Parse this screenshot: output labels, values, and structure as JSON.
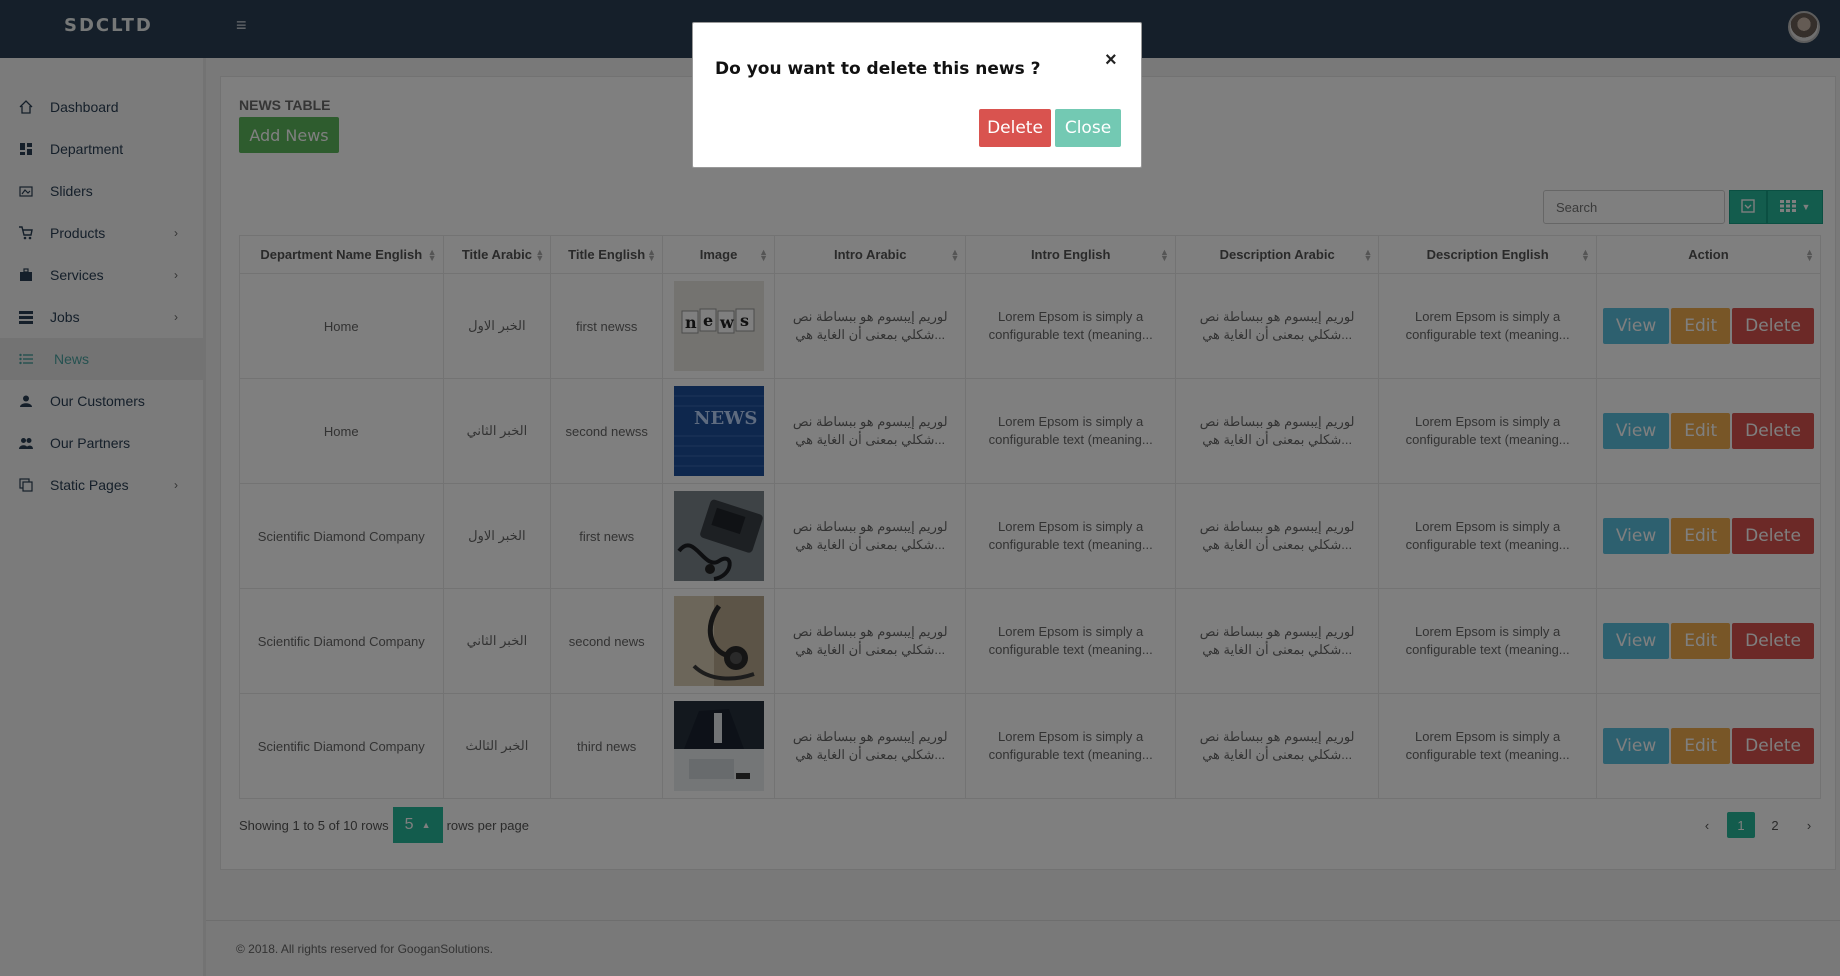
{
  "app": {
    "brand": "SDCLTD"
  },
  "sidebar": {
    "items": [
      {
        "label": "Dashboard",
        "icon": "home-icon",
        "has_children": false
      },
      {
        "label": "Department",
        "icon": "dashboard-grid-icon",
        "has_children": false
      },
      {
        "label": "Sliders",
        "icon": "sliders-icon",
        "has_children": false
      },
      {
        "label": "Products",
        "icon": "cart-icon",
        "has_children": true
      },
      {
        "label": "Services",
        "icon": "briefcase-icon",
        "has_children": true
      },
      {
        "label": "Jobs",
        "icon": "list-icon",
        "has_children": true
      },
      {
        "label": "News",
        "icon": "list-bullet-icon",
        "has_children": false,
        "active": true
      },
      {
        "label": "Our Customers",
        "icon": "person-icon",
        "has_children": false
      },
      {
        "label": "Our Partners",
        "icon": "people-icon",
        "has_children": false
      },
      {
        "label": "Static Pages",
        "icon": "pages-icon",
        "has_children": true
      }
    ]
  },
  "main": {
    "panel_title": "NEWS TABLE",
    "add_button": "Add News",
    "search_placeholder": "Search",
    "columns": [
      "Department Name English",
      "Title Arabic",
      "Title English",
      "Image",
      "Intro Arabic",
      "Intro English",
      "Description Arabic",
      "Description English",
      "Action"
    ],
    "rows": [
      {
        "dept": "Home",
        "title_ar": "الخبر الاول",
        "title_en": "first newss",
        "image": "news-letters",
        "intro_ar_1": "لوريم إيبسوم هو ببساطة نص",
        "intro_ar_2": "...شكلي بمعنى أن الغاية هي",
        "intro_en_1": "Lorem Epsom is simply a",
        "intro_en_2": "configurable text (meaning...",
        "desc_ar_1": "لوريم إيبسوم هو ببساطة نص",
        "desc_ar_2": "...شكلي بمعنى أن الغاية هي",
        "desc_en_1": "Lorem Epsom is simply a",
        "desc_en_2": "configurable text (meaning..."
      },
      {
        "dept": "Home",
        "title_ar": "الخبر الثاني",
        "title_en": "second newss",
        "image": "news-blue-screen",
        "intro_ar_1": "لوريم إيبسوم هو ببساطة نص",
        "intro_ar_2": "...شكلي بمعنى أن الغاية هي",
        "intro_en_1": "Lorem Epsom is simply a",
        "intro_en_2": "configurable text (meaning...",
        "desc_ar_1": "لوريم إيبسوم هو ببساطة نص",
        "desc_ar_2": "...شكلي بمعنى أن الغاية هي",
        "desc_en_1": "Lorem Epsom is simply a",
        "desc_en_2": "configurable text (meaning..."
      },
      {
        "dept": "Scientific Diamond Company",
        "title_ar": "الخبر الاول",
        "title_en": "first news",
        "image": "medical-device",
        "intro_ar_1": "لوريم إيبسوم هو ببساطة نص",
        "intro_ar_2": "...شكلي بمعنى أن الغاية هي",
        "intro_en_1": "Lorem Epsom is simply a",
        "intro_en_2": "configurable text (meaning...",
        "desc_ar_1": "لوريم إيبسوم هو ببساطة نص",
        "desc_ar_2": "...شكلي بمعنى أن الغاية هي",
        "desc_en_1": "Lorem Epsom is simply a",
        "desc_en_2": "configurable text (meaning..."
      },
      {
        "dept": "Scientific Diamond Company",
        "title_ar": "الخبر الثاني",
        "title_en": "second news",
        "image": "stethoscope",
        "intro_ar_1": "لوريم إيبسوم هو ببساطة نص",
        "intro_ar_2": "...شكلي بمعنى أن الغاية هي",
        "intro_en_1": "Lorem Epsom is simply a",
        "intro_en_2": "configurable text (meaning...",
        "desc_ar_1": "لوريم إيبسوم هو ببساطة نص",
        "desc_ar_2": "...شكلي بمعنى أن الغاية هي",
        "desc_en_1": "Lorem Epsom is simply a",
        "desc_en_2": "configurable text (meaning..."
      },
      {
        "dept": "Scientific Diamond Company",
        "title_ar": "الخبر الثالث",
        "title_en": "third news",
        "image": "doctor-desk",
        "intro_ar_1": "لوريم إيبسوم هو ببساطة نص",
        "intro_ar_2": "...شكلي بمعنى أن الغاية هي",
        "intro_en_1": "Lorem Epsom is simply a",
        "intro_en_2": "configurable text (meaning...",
        "desc_ar_1": "لوريم إيبسوم هو ببساطة نص",
        "desc_ar_2": "...شكلي بمعنى أن الغاية هي",
        "desc_en_1": "Lorem Epsom is simply a",
        "desc_en_2": "configurable text (meaning..."
      }
    ],
    "actions": {
      "view": "View",
      "edit": "Edit",
      "delete": "Delete"
    },
    "pagination": {
      "showing_text": "Showing 1 to 5 of 10 rows",
      "per_page_value": "5",
      "per_page_suffix": "rows per page",
      "prev": "‹",
      "pages": [
        "1",
        "2"
      ],
      "next": "›"
    }
  },
  "footer": {
    "copyright": "© 2018. All rights reserved for GooganSolutions."
  },
  "modal": {
    "title": "Do you want to delete this news ?",
    "close_icon": "×",
    "delete_label": "Delete",
    "close_label": "Close"
  },
  "colors": {
    "topbar": "#2a3f54",
    "accent": "#26b99a",
    "danger": "#d9534f",
    "warning": "#f0ad4e",
    "info": "#5bc0de",
    "success": "#5cb85c"
  }
}
